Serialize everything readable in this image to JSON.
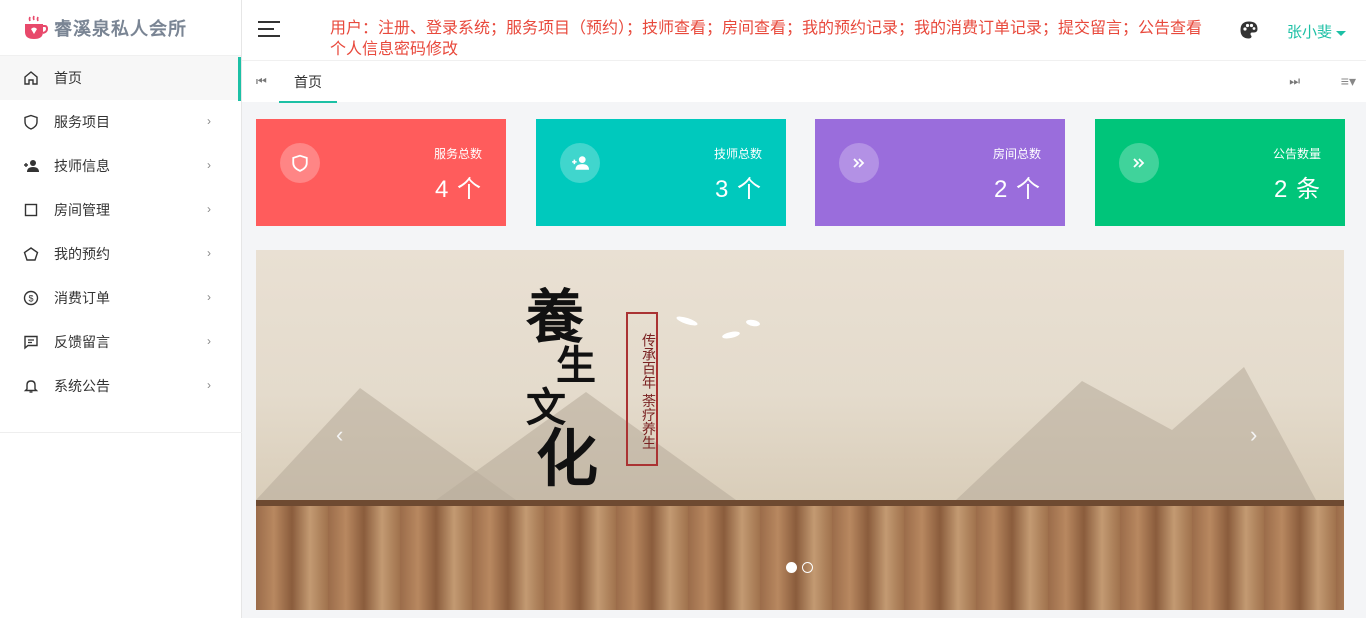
{
  "app": {
    "title": "睿溪泉私人会所"
  },
  "sidebar": {
    "items": [
      {
        "label": "首页",
        "icon": "home-icon"
      },
      {
        "label": "服务项目",
        "icon": "shield-icon"
      },
      {
        "label": "技师信息",
        "icon": "user-add-icon"
      },
      {
        "label": "房间管理",
        "icon": "square-icon"
      },
      {
        "label": "我的预约",
        "icon": "pentagon-icon"
      },
      {
        "label": "消费订单",
        "icon": "dollar-circle-icon"
      },
      {
        "label": "反馈留言",
        "icon": "message-icon"
      },
      {
        "label": "系统公告",
        "icon": "bell-icon"
      }
    ]
  },
  "header": {
    "notice": "用户：注册、登录系统；服务项目（预约）；技师查看；房间查看；我的预约记录；我的消费订单记录；提交留言；公告查看 个人信息密码修改",
    "user_name": "张小斐"
  },
  "tabs": {
    "home_label": "首页"
  },
  "cards": [
    {
      "label": "服务总数",
      "value": "4 个",
      "color": "#ff5c5c",
      "icon": "shield-icon"
    },
    {
      "label": "技师总数",
      "value": "3 个",
      "color": "#00c9bd",
      "icon": "user-add-icon"
    },
    {
      "label": "房间总数",
      "value": "2 个",
      "color": "#9a6ddc",
      "icon": "double-chevron-icon"
    },
    {
      "label": "公告数量",
      "value": "2 条",
      "color": "#00c57a",
      "icon": "double-chevron-icon"
    }
  ],
  "banner": {
    "calligraphy": [
      "養",
      "生",
      "文",
      "化"
    ],
    "seal_text": "传承百年 荼疗养生",
    "prev": "‹",
    "next": "›",
    "active_slide": 1,
    "slide_count": 2
  }
}
